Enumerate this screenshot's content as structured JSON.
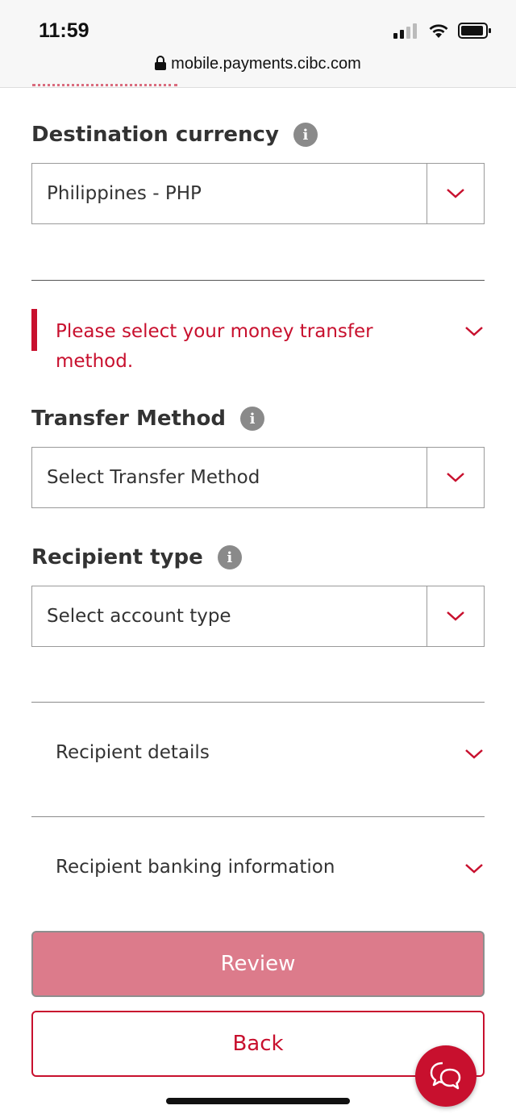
{
  "status_bar": {
    "time": "11:59",
    "url": "mobile.payments.cibc.com"
  },
  "destination_currency": {
    "label": "Destination currency",
    "value": "Philippines - PHP"
  },
  "error": {
    "message": "Please select your money transfer method."
  },
  "transfer_method": {
    "label": "Transfer Method",
    "placeholder": "Select Transfer Method"
  },
  "recipient_type": {
    "label": "Recipient type",
    "placeholder": "Select account type"
  },
  "sections": {
    "recipient_details": "Recipient details",
    "recipient_banking": "Recipient banking information"
  },
  "buttons": {
    "review": "Review",
    "back": "Back"
  },
  "colors": {
    "brand_red": "#c8102e",
    "disabled_red": "#dc7b8b",
    "info_gray": "#8a8a8a"
  }
}
